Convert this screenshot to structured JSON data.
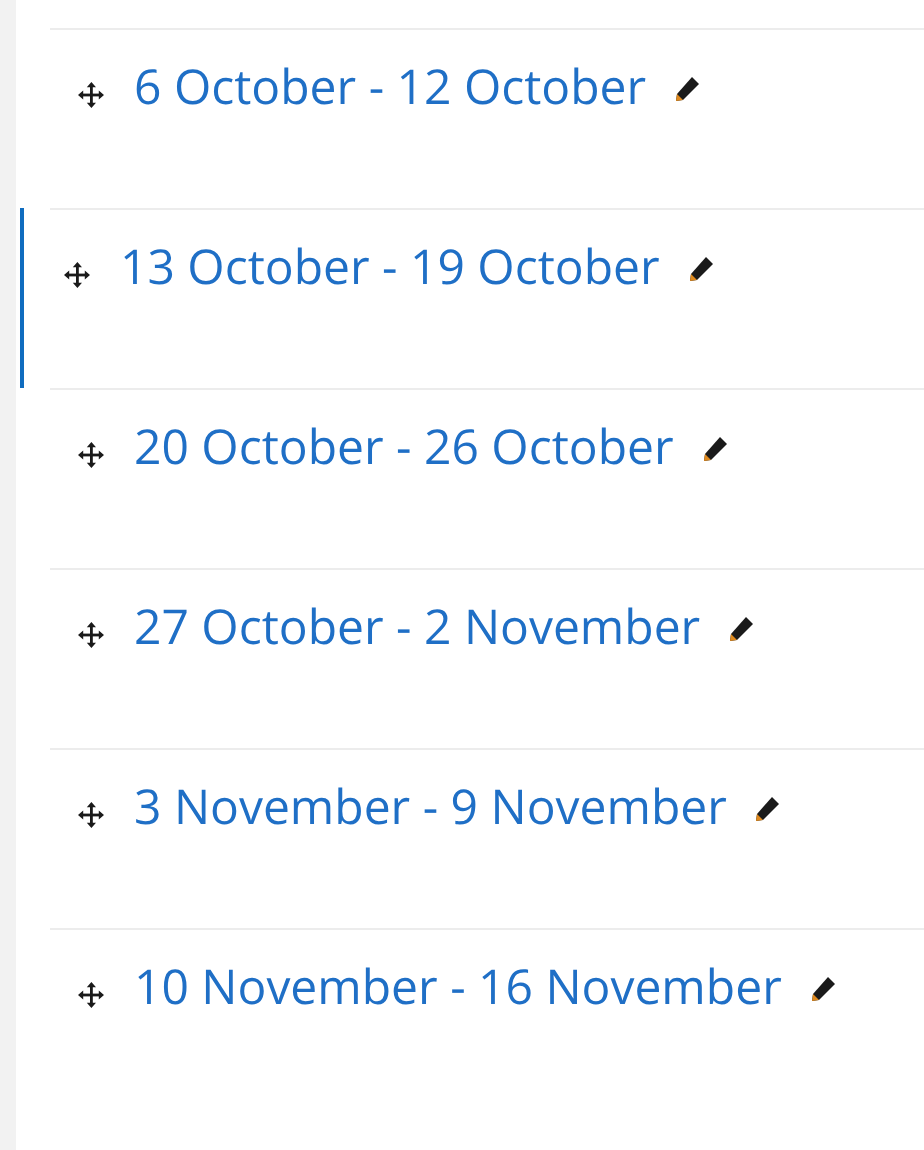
{
  "sections": [
    {
      "title": "6 October - 12 October",
      "highlighted": false
    },
    {
      "title": "13 October - 19 October",
      "highlighted": true
    },
    {
      "title": "20 October - 26 October",
      "highlighted": false
    },
    {
      "title": "27 October - 2 November",
      "highlighted": false
    },
    {
      "title": "3 November - 9 November",
      "highlighted": false
    },
    {
      "title": "10 November - 16 November",
      "highlighted": false
    }
  ]
}
